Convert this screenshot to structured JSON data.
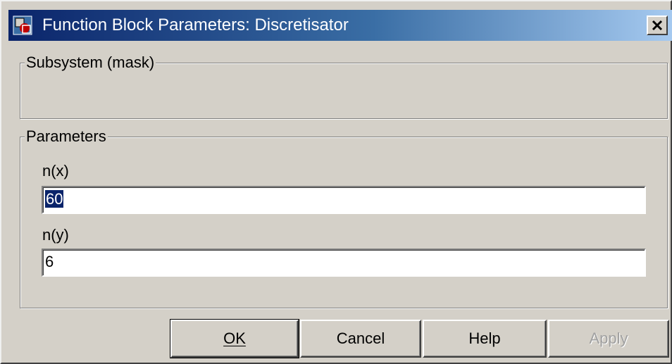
{
  "window": {
    "title": "Function Block Parameters: Discretisator",
    "icon": "simulink-block-icon",
    "close_icon": "close-icon"
  },
  "subsystem_group": {
    "label": "Subsystem (mask)"
  },
  "parameters_group": {
    "label": "Parameters",
    "fields": [
      {
        "label": "n(x)",
        "value": "60"
      },
      {
        "label": "n(y)",
        "value": "6"
      }
    ]
  },
  "buttons": {
    "ok": "OK",
    "cancel": "Cancel",
    "help": "Help",
    "apply": "Apply"
  },
  "colors": {
    "dialog_face": "#d4d0c8",
    "titlebar_start": "#0a246a",
    "titlebar_end": "#a6caf0",
    "selection": "#0a246a",
    "disabled_text": "#a0a0a0"
  }
}
